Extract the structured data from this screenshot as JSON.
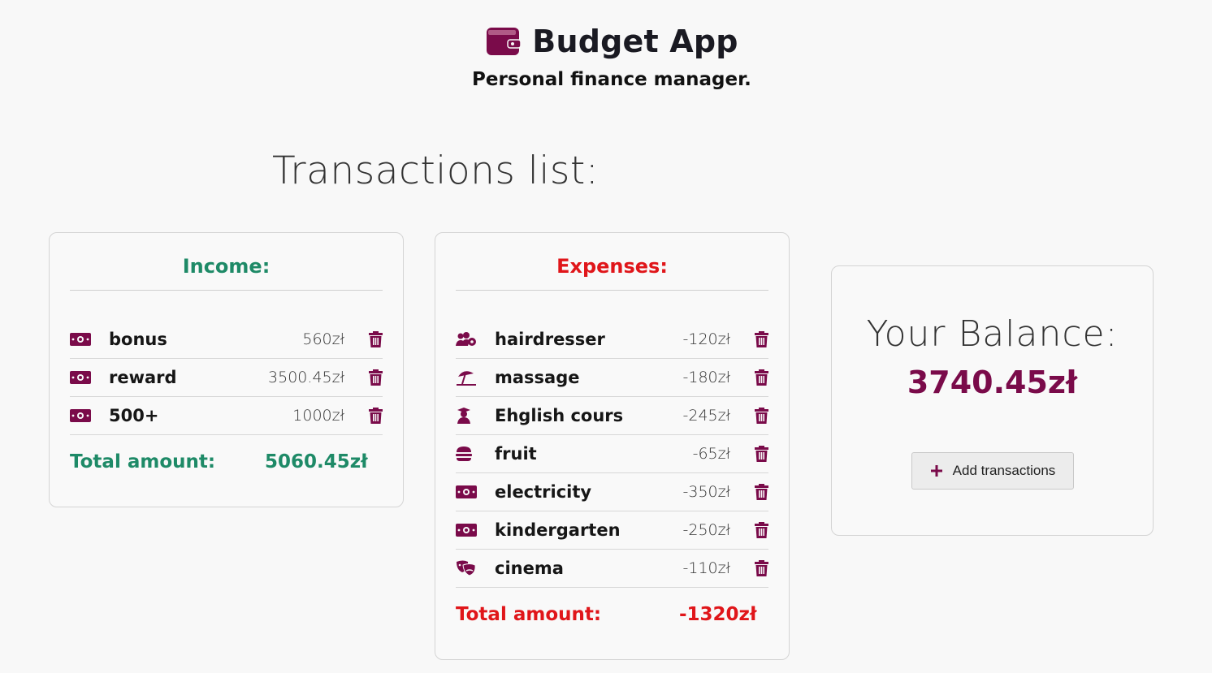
{
  "app": {
    "title": "Budget App",
    "subtitle": "Personal finance manager.",
    "icon": "wallet-icon"
  },
  "section_title": "Transactions list:",
  "colors": {
    "brand": "#7a0b4a",
    "income": "#1e8a67",
    "expense": "#e0161a",
    "background": "#f8f8f8"
  },
  "income": {
    "heading": "Income:",
    "items": [
      {
        "name": "bonus",
        "amount": "560zł",
        "icon": "money-bill-icon"
      },
      {
        "name": "reward",
        "amount": "3500.45zł",
        "icon": "money-bill-icon"
      },
      {
        "name": "500+",
        "amount": "1000zł",
        "icon": "money-bill-icon"
      }
    ],
    "total_label": "Total amount:",
    "total_value": "5060.45zł"
  },
  "expenses": {
    "heading": "Expenses:",
    "items": [
      {
        "name": "hairdresser",
        "amount": "-120zł",
        "icon": "users-cog-icon"
      },
      {
        "name": "massage",
        "amount": "-180zł",
        "icon": "umbrella-beach-icon"
      },
      {
        "name": "Ehglish cours",
        "amount": "-245zł",
        "icon": "graduate-icon"
      },
      {
        "name": "fruit",
        "amount": "-65zł",
        "icon": "burger-icon"
      },
      {
        "name": "electricity",
        "amount": "-350zł",
        "icon": "money-bill-icon"
      },
      {
        "name": "kindergarten",
        "amount": "-250zł",
        "icon": "money-bill-icon"
      },
      {
        "name": "cinema",
        "amount": "-110zł",
        "icon": "theater-masks-icon"
      }
    ],
    "total_label": "Total amount:",
    "total_value": "-1320zł"
  },
  "balance": {
    "label": "Your Balance:",
    "value": "3740.45zł",
    "add_button_label": "Add transactions",
    "add_button_icon": "plus-icon"
  }
}
